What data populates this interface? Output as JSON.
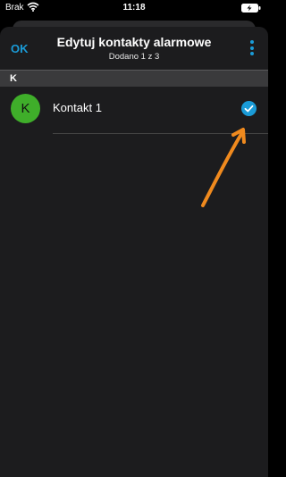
{
  "status_bar": {
    "carrier": "Brak",
    "time": "11:18",
    "wifi_icon": "wifi-icon",
    "battery_icon": "battery-charging-icon"
  },
  "nav": {
    "ok_label": "OK",
    "title": "Edytuj kontakty alarmowe",
    "subtitle": "Dodano 1 z 3",
    "more_icon": "more-vertical-icon"
  },
  "section": {
    "header": "K"
  },
  "contacts": [
    {
      "initial": "K",
      "name": "Kontakt 1",
      "selected": true,
      "avatar_color": "#3fae2a"
    }
  ],
  "colors": {
    "accent": "#1a9bd7",
    "background": "#000000",
    "sheet": "#1c1c1e",
    "section_header": "#3a3a3c",
    "annotation_arrow": "#f08a1e"
  }
}
